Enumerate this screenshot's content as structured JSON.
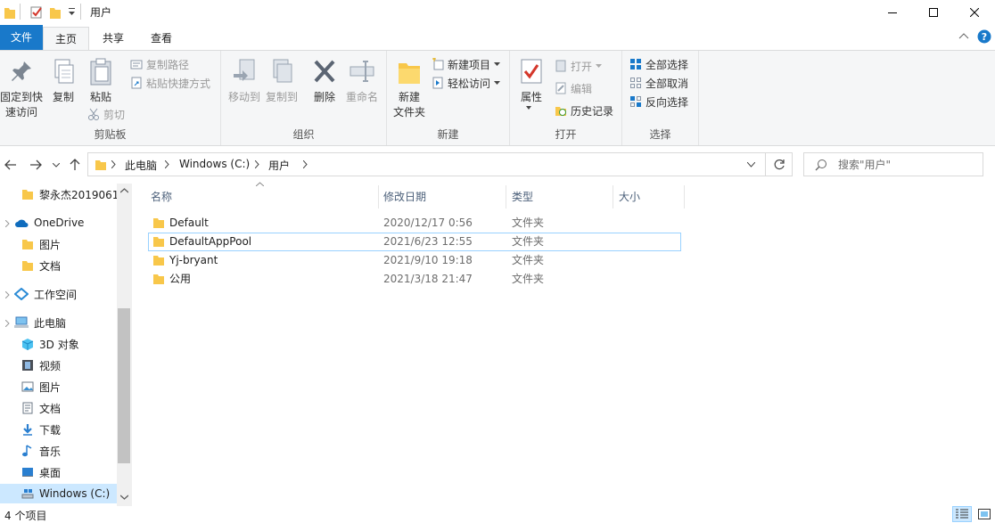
{
  "window": {
    "title": "用户"
  },
  "tabs": {
    "file": "文件",
    "home": "主页",
    "share": "共享",
    "view": "查看"
  },
  "ribbon": {
    "clipboard": {
      "group": "剪贴板",
      "pin_line1": "固定到快",
      "pin_line2": "速访问",
      "copy": "复制",
      "paste": "粘贴",
      "copy_path": "复制路径",
      "paste_shortcut": "粘贴快捷方式",
      "cut": "剪切"
    },
    "organize": {
      "group": "组织",
      "move_to": "移动到",
      "copy_to": "复制到",
      "delete": "删除",
      "rename": "重命名"
    },
    "new": {
      "group": "新建",
      "new_folder_line1": "新建",
      "new_folder_line2": "文件夹",
      "new_item": "新建项目",
      "easy_access": "轻松访问"
    },
    "open": {
      "group": "打开",
      "properties": "属性",
      "open": "打开",
      "edit": "编辑",
      "history": "历史记录"
    },
    "select": {
      "group": "选择",
      "select_all": "全部选择",
      "select_none": "全部取消",
      "invert": "反向选择"
    }
  },
  "address": {
    "crumbs": [
      "此电脑",
      "Windows (C:)",
      "用户"
    ],
    "search_placeholder": "搜索\"用户\""
  },
  "nav": [
    {
      "label": "黎永杰2019061",
      "icon": "folder-icon"
    },
    {
      "label": "OneDrive",
      "icon": "onedrive-icon"
    },
    {
      "label": "图片",
      "icon": "folder-icon"
    },
    {
      "label": "文档",
      "icon": "folder-icon"
    },
    {
      "label": "工作空间",
      "icon": "workspace-icon"
    },
    {
      "label": "此电脑",
      "icon": "this-pc-icon"
    },
    {
      "label": "3D 对象",
      "icon": "3d-objects-icon"
    },
    {
      "label": "视频",
      "icon": "videos-icon"
    },
    {
      "label": "图片",
      "icon": "pictures-icon"
    },
    {
      "label": "文档",
      "icon": "documents-icon"
    },
    {
      "label": "下载",
      "icon": "downloads-icon"
    },
    {
      "label": "音乐",
      "icon": "music-icon"
    },
    {
      "label": "桌面",
      "icon": "desktop-icon"
    },
    {
      "label": "Windows (C:)",
      "icon": "drive-icon"
    }
  ],
  "columns": {
    "name": "名称",
    "date": "修改日期",
    "type": "类型",
    "size": "大小"
  },
  "files": [
    {
      "name": "Default",
      "date": "2020/12/17 0:56",
      "type": "文件夹"
    },
    {
      "name": "DefaultAppPool",
      "date": "2021/6/23 12:55",
      "type": "文件夹"
    },
    {
      "name": "Yj-bryant",
      "date": "2021/9/10 19:18",
      "type": "文件夹"
    },
    {
      "name": "公用",
      "date": "2021/3/18 21:47",
      "type": "文件夹"
    }
  ],
  "status": {
    "count": "4 个项目"
  },
  "colors": {
    "accent": "#1979ca",
    "folder": "#f8c74a",
    "selection": "#cce8ff"
  }
}
